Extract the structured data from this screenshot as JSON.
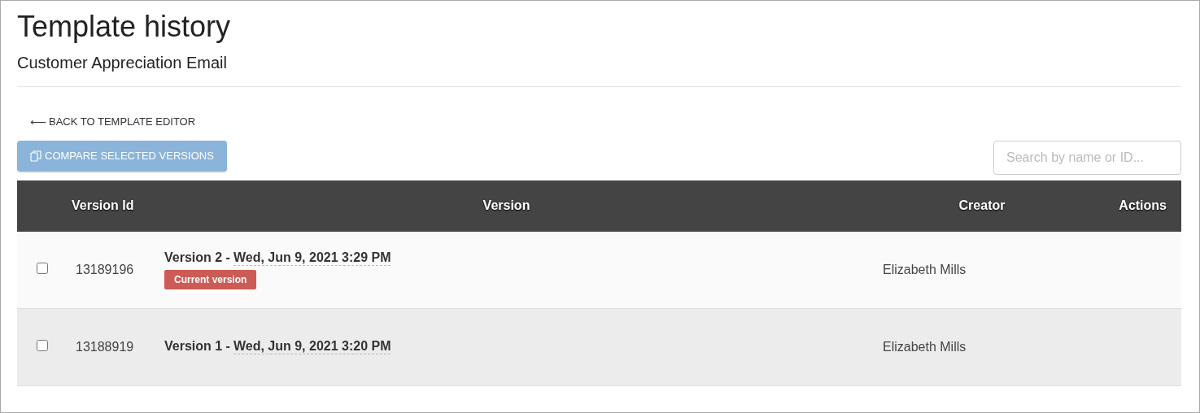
{
  "page": {
    "title": "Template history",
    "subtitle": "Customer Appreciation Email"
  },
  "back_link": {
    "arrow": "⟵",
    "label": "BACK TO TEMPLATE EDITOR"
  },
  "compare_button": {
    "label": "COMPARE SELECTED VERSIONS",
    "disabled": true
  },
  "search": {
    "placeholder": "Search by name or ID..."
  },
  "table": {
    "columns": [
      "Version Id",
      "Version",
      "Creator",
      "Actions"
    ],
    "rows": [
      {
        "checked": false,
        "id": "13189196",
        "version": "Version 2 -",
        "date": "Wed, Jun 9, 2021 3:29 PM",
        "badge": "Current version",
        "creator": "Elizabeth Mills"
      },
      {
        "checked": false,
        "id": "13188919",
        "version": "Version 1 -",
        "date": "Wed, Jun 9, 2021 3:20 PM",
        "creator": "Elizabeth Mills"
      }
    ]
  }
}
